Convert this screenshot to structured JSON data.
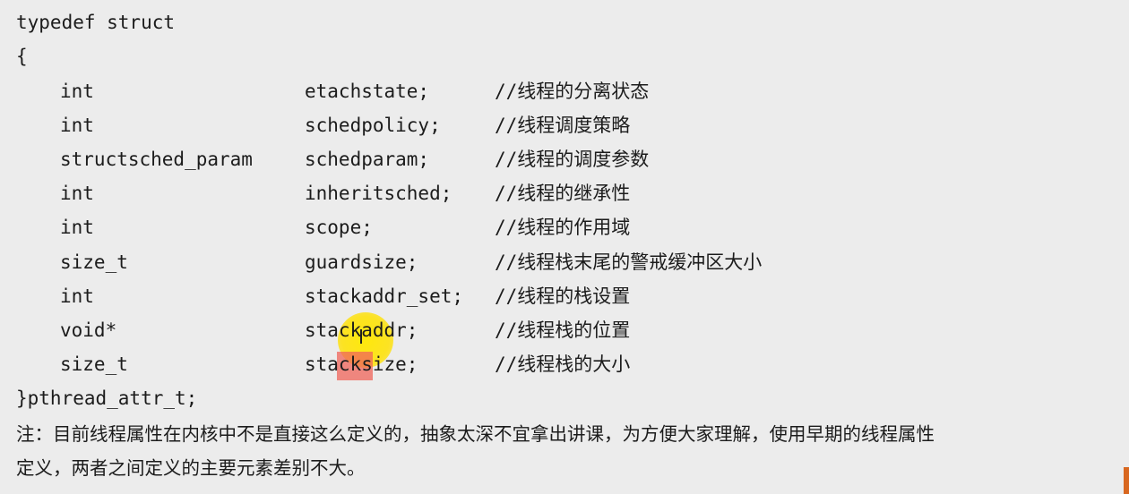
{
  "code": {
    "open_line": "typedef struct",
    "brace_open": "{",
    "fields": [
      {
        "type": "int",
        "name": "etachstate;",
        "comment": "//线程的分离状态"
      },
      {
        "type": "int",
        "name": "schedpolicy;",
        "comment": "//线程调度策略"
      },
      {
        "type": "structsched_param",
        "name": "schedparam;",
        "comment": "//线程的调度参数"
      },
      {
        "type": "int",
        "name": "inheritsched;",
        "comment": "//线程的继承性"
      },
      {
        "type": "int",
        "name": "scope;",
        "comment": "//线程的作用域"
      },
      {
        "type": "size_t",
        "name": "guardsize;",
        "comment": "//线程栈末尾的警戒缓冲区大小"
      },
      {
        "type": "int",
        "name": "stackaddr_set;",
        "comment": "//线程的栈设置"
      },
      {
        "type": "void*",
        "name": "stackaddr;",
        "comment": "//线程栈的位置"
      },
      {
        "type": "size_t",
        "name": "stacksize;",
        "comment": "//线程栈的大小"
      }
    ],
    "close_line": "}pthread_attr_t;"
  },
  "note": {
    "line1": "注：目前线程属性在内核中不是直接这么定义的，抽象太深不宜拿出讲课，为方便大家理解，使用早期的线程属性",
    "line2": "定义，两者之间定义的主要元素差别不大。"
  }
}
